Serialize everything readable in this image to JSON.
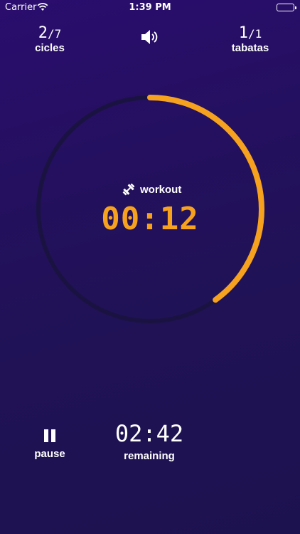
{
  "status_bar": {
    "carrier": "Carrier",
    "time": "1:39 PM"
  },
  "cycles": {
    "current": "2",
    "total": "/7",
    "label": "cicles"
  },
  "tabatas": {
    "current": "1",
    "total": "/1",
    "label": "tabatas"
  },
  "sound": {
    "icon": "speaker-icon"
  },
  "timer": {
    "phase_label": "workout",
    "phase_icon": "dumbbell-icon",
    "value": "00:12",
    "progress_fraction": 0.4,
    "accent_color": "#f6a21e",
    "track_color": "#1a1342"
  },
  "controls": {
    "pause_label": "pause",
    "pause_icon": "pause-icon",
    "remaining_time": "02:42",
    "remaining_label": "remaining"
  }
}
